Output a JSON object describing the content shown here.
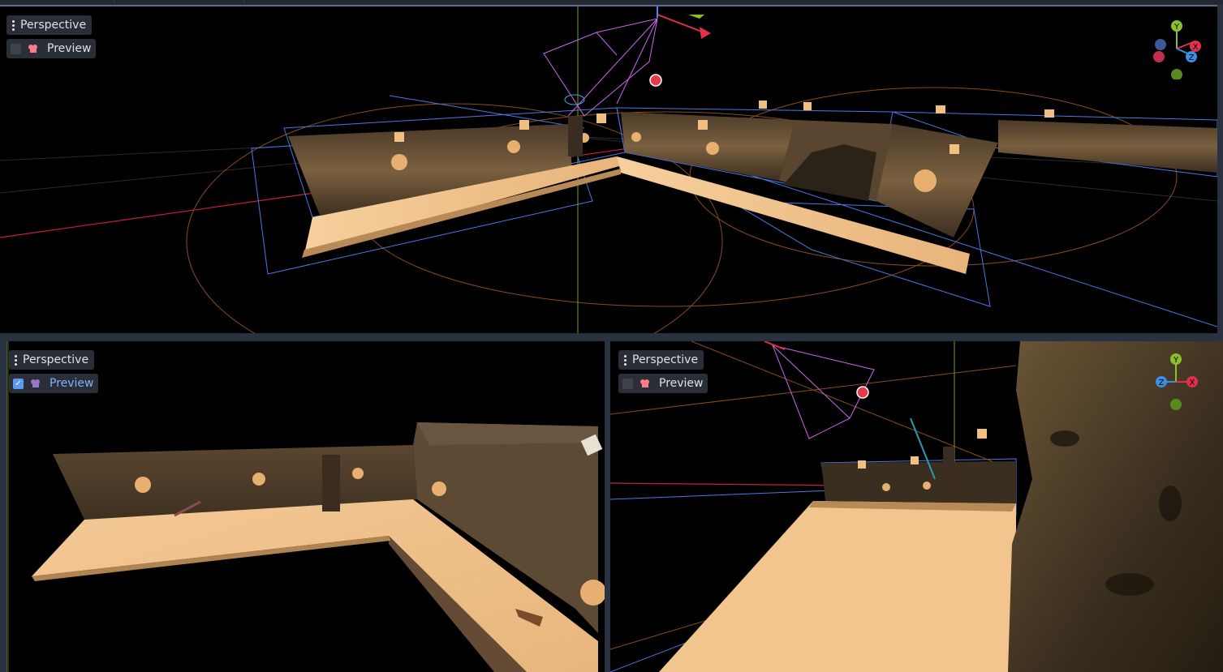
{
  "viewports": {
    "top": {
      "menu_label": "Perspective",
      "preview_label": "Preview",
      "preview_checked": false
    },
    "bottom_left": {
      "menu_label": "Perspective",
      "preview_label": "Preview",
      "preview_checked": true
    },
    "bottom_right": {
      "menu_label": "Perspective",
      "preview_label": "Preview",
      "preview_checked": false
    }
  },
  "gizmo": {
    "y": "Y",
    "x": "X",
    "z": "Z"
  },
  "colors": {
    "axis_x": "#e0304a",
    "axis_y": "#8ac02c",
    "axis_z": "#3a8ee6",
    "wire_blue": "#4a78e8",
    "wire_orange": "#b8651f",
    "camera_pink": "#cc66ee",
    "floor": "#f3c590",
    "wall": "#6a5438"
  },
  "icons": [
    "kebab-menu-icon",
    "camera-preview-icon",
    "checkbox-icon",
    "orientation-gizmo-icon"
  ]
}
